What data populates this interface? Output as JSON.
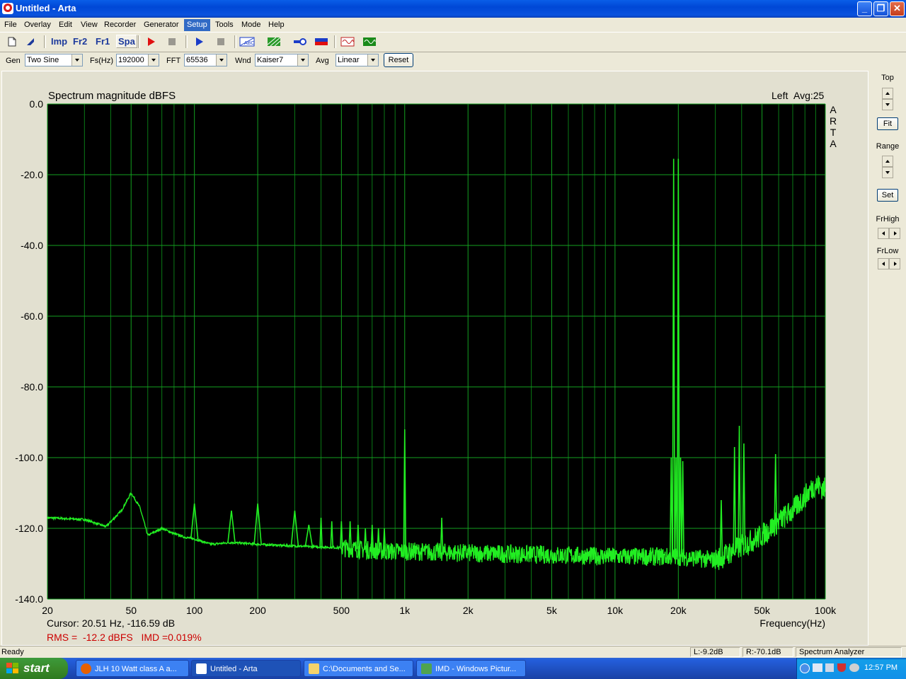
{
  "window": {
    "title": "Untitled - Arta"
  },
  "menu": [
    "File",
    "Overlay",
    "Edit",
    "View",
    "Recorder",
    "Generator",
    "Setup",
    "Tools",
    "Mode",
    "Help"
  ],
  "menu_active": "Setup",
  "toolbar": {
    "imp": "Imp",
    "fr2": "Fr2",
    "fr1": "Fr1",
    "spa": "Spa"
  },
  "options": {
    "gen_label": "Gen",
    "gen_value": "Two Sine",
    "fs_label": "Fs(Hz)",
    "fs_value": "192000",
    "fft_label": "FFT",
    "fft_value": "65536",
    "wnd_label": "Wnd",
    "wnd_value": "Kaiser7",
    "avg_label": "Avg",
    "avg_value": "Linear",
    "reset_label": "Reset"
  },
  "right_panel": {
    "top_label": "Top",
    "fit_label": "Fit",
    "range_label": "Range",
    "set_label": "Set",
    "frhigh_label": "FrHigh",
    "frlow_label": "FrLow"
  },
  "readouts": {
    "cursor": "Cursor: 20.51 Hz, -116.59 dB",
    "rms": "RMS =  -12.2 dBFS   IMD =0.019%"
  },
  "status": {
    "ready": "Ready",
    "left_level": "L:-9.2dB",
    "right_level": "R:-70.1dB",
    "mode": "Spectrum Analyzer"
  },
  "taskbar": {
    "start": "start",
    "tasks": [
      "JLH 10 Watt class A a...",
      "Untitled - Arta",
      "C:\\Documents and Se...",
      "IMD - Windows Pictur..."
    ],
    "clock": "12:57 PM"
  },
  "colors": {
    "plot_bg": "#000000",
    "grid": "#0a7a16",
    "trace": "#22ee22",
    "rms_text": "#cc0000"
  },
  "chart_data": {
    "type": "line",
    "title": "Spectrum magnitude dBFS",
    "channel_label": "Left",
    "avg_label": "Avg:25",
    "watermark": "ARTA",
    "xlabel": "Frequency(Hz)",
    "ylabel": "",
    "x_scale": "log",
    "xlim": [
      20,
      100000
    ],
    "ylim": [
      -140,
      0
    ],
    "grid": true,
    "x_ticks": [
      20,
      50,
      100,
      200,
      500,
      1000,
      2000,
      5000,
      10000,
      20000,
      50000,
      100000
    ],
    "x_tick_labels": [
      "20",
      "50",
      "100",
      "200",
      "500",
      "1k",
      "2k",
      "5k",
      "10k",
      "20k",
      "50k",
      "100k"
    ],
    "y_ticks": [
      0,
      -20,
      -40,
      -60,
      -80,
      -100,
      -120,
      -140
    ],
    "y_tick_labels": [
      "0.0",
      "-20.0",
      "-40.0",
      "-60.0",
      "-80.0",
      "-100.0",
      "-120.0",
      "-140.0"
    ],
    "series": [
      {
        "floor": [
          [
            20,
            -117
          ],
          [
            30,
            -117.5
          ],
          [
            38,
            -119.5
          ],
          [
            45,
            -115
          ],
          [
            50,
            -110
          ],
          [
            55,
            -114
          ],
          [
            60,
            -122
          ],
          [
            70,
            -120
          ],
          [
            80,
            -121.5
          ],
          [
            90,
            -122.5
          ],
          [
            100,
            -123
          ],
          [
            120,
            -124.5
          ],
          [
            150,
            -124
          ],
          [
            200,
            -124.5
          ],
          [
            300,
            -125
          ],
          [
            500,
            -125.5
          ],
          [
            800,
            -126.5
          ],
          [
            1000,
            -126.5
          ],
          [
            2000,
            -127
          ],
          [
            5000,
            -127.5
          ],
          [
            10000,
            -128
          ],
          [
            15000,
            -128
          ],
          [
            20000,
            -128
          ],
          [
            25000,
            -128.5
          ],
          [
            30000,
            -129
          ],
          [
            35000,
            -127
          ],
          [
            40000,
            -125
          ],
          [
            50000,
            -122
          ],
          [
            60000,
            -118
          ],
          [
            70000,
            -115
          ],
          [
            80000,
            -111
          ],
          [
            90000,
            -107.5
          ],
          [
            100000,
            -109
          ]
        ],
        "peaks": [
          [
            100,
            -113
          ],
          [
            150,
            -115
          ],
          [
            200,
            -113
          ],
          [
            300,
            -115
          ],
          [
            350,
            -119
          ],
          [
            400,
            -117
          ],
          [
            450,
            -118
          ],
          [
            500,
            -118
          ],
          [
            550,
            -118
          ],
          [
            600,
            -119
          ],
          [
            650,
            -120
          ],
          [
            700,
            -119
          ],
          [
            750,
            -120
          ],
          [
            800,
            -120
          ],
          [
            1000,
            -92
          ],
          [
            1500,
            -117
          ],
          [
            18500,
            -100
          ],
          [
            19000,
            -15.5
          ],
          [
            19500,
            -100
          ],
          [
            20000,
            -15.5
          ],
          [
            20500,
            -100
          ],
          [
            21000,
            -101
          ],
          [
            32000,
            -112
          ],
          [
            37000,
            -97
          ],
          [
            39000,
            -91
          ],
          [
            41000,
            -96
          ],
          [
            58000,
            -99
          ]
        ]
      }
    ]
  }
}
